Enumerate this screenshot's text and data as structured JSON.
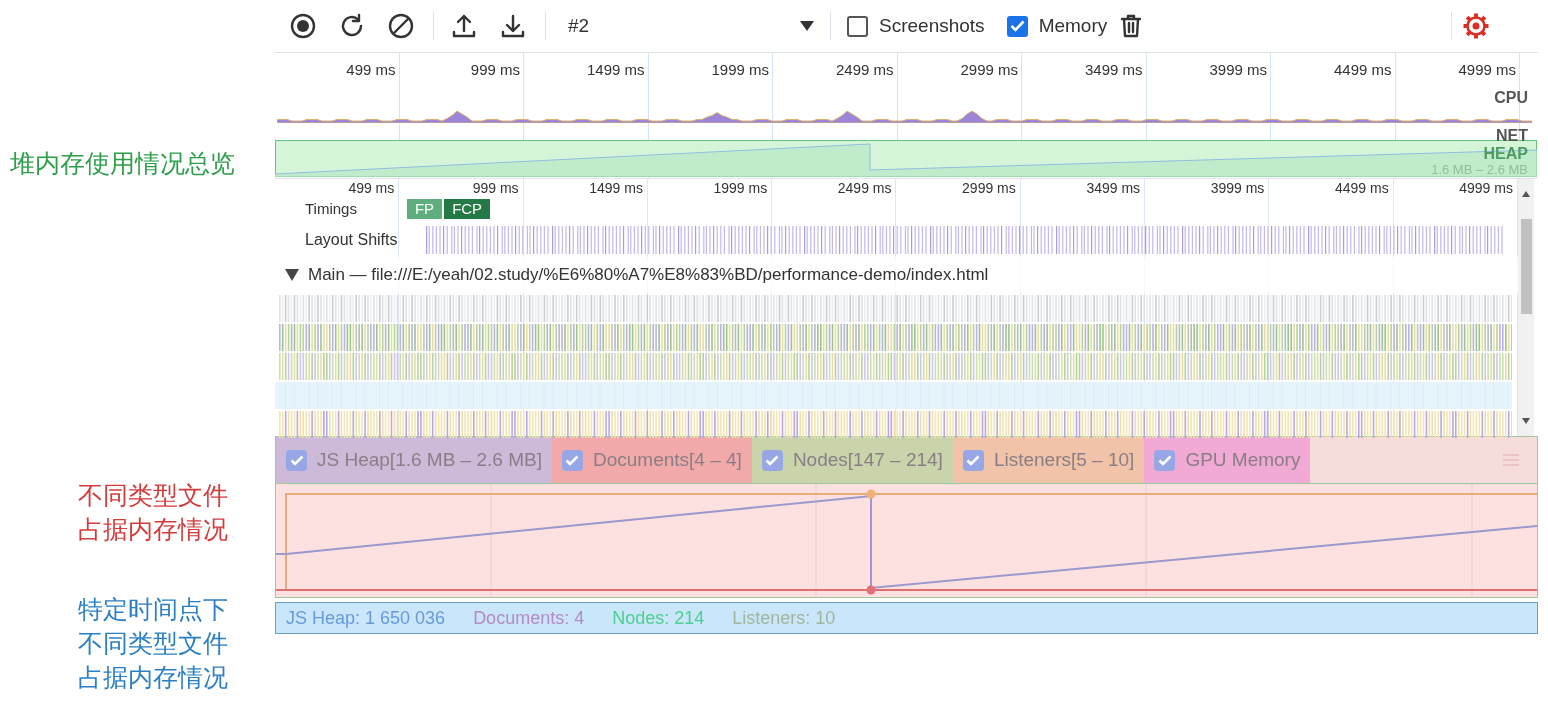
{
  "annotations": [
    {
      "lines": [
        "堆内存使用情况总览"
      ],
      "color": "#2e9e4a"
    },
    {
      "lines": [
        "不同类型文件",
        "占据内存情况"
      ],
      "color": "#d23c3c"
    },
    {
      "lines": [
        "特定时间点下",
        "不同类型文件",
        "占据内存情况"
      ],
      "color": "#2b7fc4"
    }
  ],
  "toolbar": {
    "recording": "#2",
    "options": [
      {
        "label": "Screenshots",
        "checked": false
      },
      {
        "label": "Memory",
        "checked": true
      }
    ]
  },
  "overview": {
    "ticks": [
      "499 ms",
      "999 ms",
      "1499 ms",
      "1999 ms",
      "2499 ms",
      "2999 ms",
      "3499 ms",
      "3999 ms",
      "4499 ms",
      "4999 ms"
    ],
    "tracks": [
      "CPU",
      "NET",
      "HEAP"
    ],
    "heap_range": "1.6 MB – 2.6 MB"
  },
  "timeline": {
    "ticks": [
      "499 ms",
      "999 ms",
      "1499 ms",
      "1999 ms",
      "2499 ms",
      "2999 ms",
      "3499 ms",
      "3999 ms",
      "4499 ms",
      "4999 ms"
    ],
    "timings": {
      "label": "Timings",
      "markers": [
        {
          "label": "FP",
          "color": "#5fae7e"
        },
        {
          "label": "FCP",
          "color": "#237a44"
        }
      ]
    },
    "layout_shifts": "Layout Shifts",
    "main": {
      "title": "Main — file:///E:/yeah/02.study/%E6%80%A7%E8%83%BD/performance-demo/index.html",
      "expanded": true
    }
  },
  "counters": [
    {
      "label": "JS Heap[1.6 MB – 2.6 MB]",
      "checked": true,
      "color": "#cdb9d8"
    },
    {
      "label": "Documents[4 – 4]",
      "checked": true,
      "color": "#f2a9a9"
    },
    {
      "label": "Nodes[147 – 214]",
      "checked": true,
      "color": "#c9d4aa"
    },
    {
      "label": "Listeners[5 – 10]",
      "checked": true,
      "color": "#f1c3a8"
    },
    {
      "label": "GPU Memory",
      "checked": true,
      "color": "#f1a9d5"
    }
  ],
  "status": [
    {
      "text": "JS Heap: 1 650 036",
      "color": "#6a9ad8"
    },
    {
      "text": "Documents: 4",
      "color": "#b48bc3"
    },
    {
      "text": "Nodes: 214",
      "color": "#4fcf8f"
    },
    {
      "text": "Listeners: 10",
      "color": "#a3b59c"
    }
  ]
}
